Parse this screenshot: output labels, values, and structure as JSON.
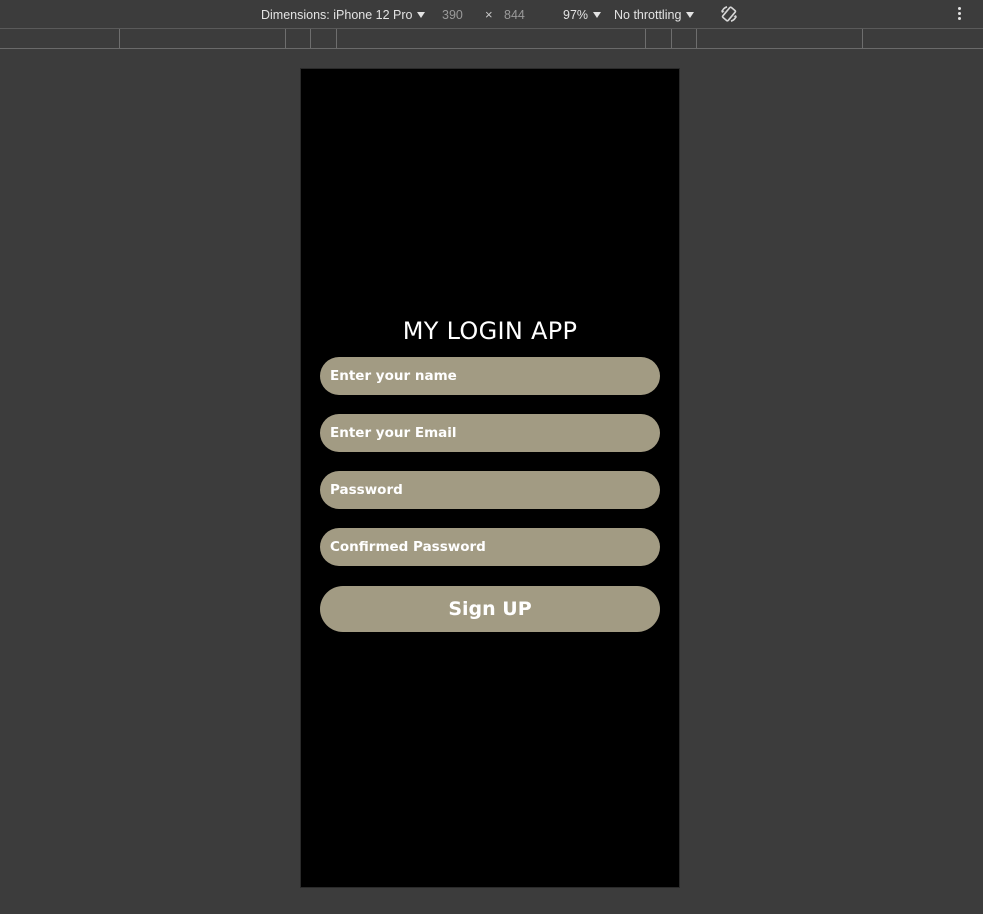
{
  "toolbar": {
    "dimensions_label": "Dimensions: iPhone 12 Pro",
    "width": "390",
    "times": "×",
    "height": "844",
    "zoom": "97%",
    "throttling": "No throttling",
    "icons": [
      "chevron-down-icon",
      "rotate-icon",
      "more-vertical-icon"
    ]
  },
  "app": {
    "title": "MY LOGIN APP",
    "fields": {
      "name_placeholder": "Enter your name",
      "email_placeholder": "Enter your Email",
      "password_placeholder": "Password",
      "confirm_placeholder": "Confirmed Password"
    },
    "signup_label": "Sign UP"
  },
  "colors": {
    "page_background": "#3c3c3c",
    "device_background": "#000000",
    "field_background": "#a29b83",
    "text": "#ffffff"
  }
}
